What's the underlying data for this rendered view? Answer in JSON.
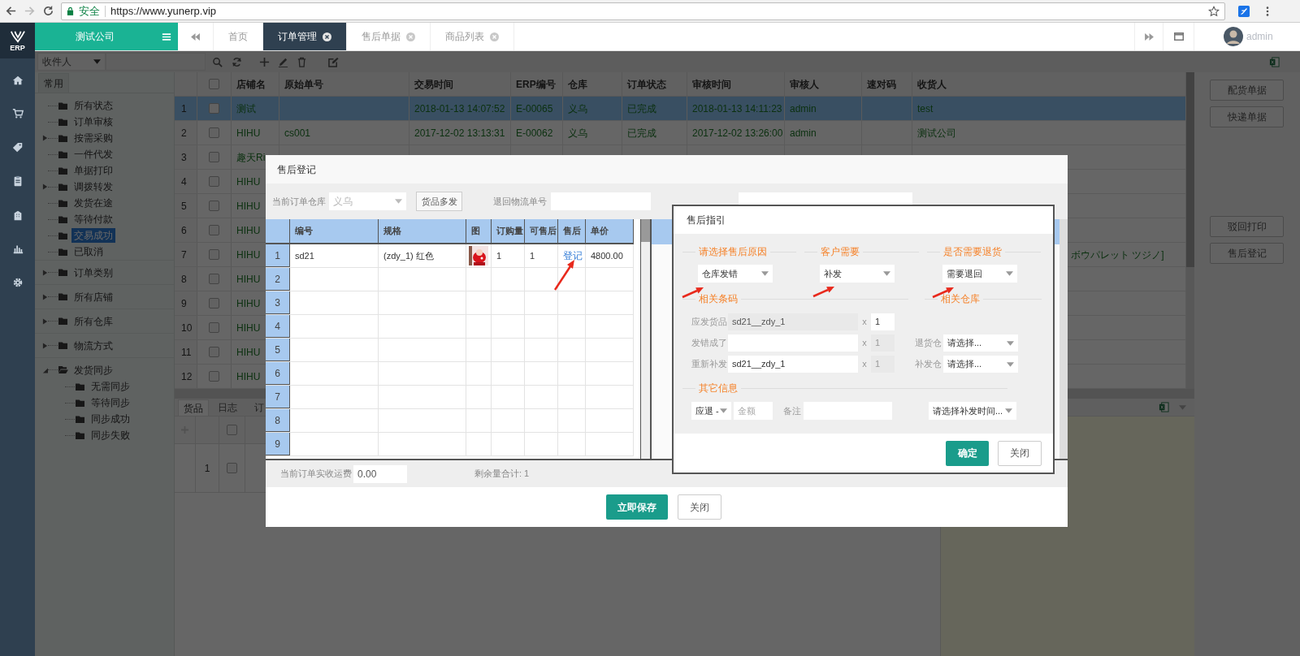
{
  "browser": {
    "security_label": "安全",
    "url": "https://www.yunerp.vip"
  },
  "logo_text": "ERP",
  "company": "测试公司",
  "tabs": [
    {
      "label": "首页",
      "selected": false,
      "closable": false
    },
    {
      "label": "订单管理",
      "selected": true,
      "closable": true
    },
    {
      "label": "售后单据",
      "selected": false,
      "closable": true
    },
    {
      "label": "商品列表",
      "selected": false,
      "closable": true
    }
  ],
  "user": "admin",
  "toolbar": {
    "filter": "收件人"
  },
  "tree": {
    "tab": "常用",
    "sections": [
      {
        "nodes": [
          {
            "label": "所有状态",
            "selected": false
          },
          {
            "label": "订单审核",
            "selected": false
          },
          {
            "label": "按需采购",
            "selected": false,
            "expanded": false
          },
          {
            "label": "一件代发",
            "selected": false
          },
          {
            "label": "单据打印",
            "selected": false
          },
          {
            "label": "调拨转发",
            "selected": false,
            "expanded": false
          },
          {
            "label": "发货在途",
            "selected": false
          },
          {
            "label": "等待付款",
            "selected": false
          },
          {
            "label": "交易成功",
            "selected": true
          },
          {
            "label": "已取消",
            "selected": false
          }
        ]
      },
      {
        "nodes": [
          {
            "label": "订单类别",
            "selected": false,
            "expanded": false
          }
        ]
      },
      {
        "nodes": [
          {
            "label": "所有店铺",
            "selected": false,
            "expanded": false
          }
        ]
      },
      {
        "nodes": [
          {
            "label": "所有仓库",
            "selected": false,
            "expanded": false
          }
        ]
      },
      {
        "nodes": [
          {
            "label": "物流方式",
            "selected": false,
            "expanded": false
          }
        ]
      },
      {
        "nodes": [
          {
            "label": "发货同步",
            "selected": false,
            "expanded": true,
            "children": [
              {
                "label": "无需同步",
                "selected": false
              },
              {
                "label": "等待同步",
                "selected": false
              },
              {
                "label": "同步成功",
                "selected": false
              },
              {
                "label": "同步失败",
                "selected": false
              }
            ]
          }
        ]
      }
    ]
  },
  "grid": {
    "select_all_checked": false,
    "columns": [
      "店铺名",
      "原始单号",
      "交易时间",
      "ERP编号",
      "仓库",
      "订单状态",
      "审核时间",
      "审核人",
      "速对码",
      "收货人"
    ],
    "rows": [
      {
        "no": "1",
        "selected": true,
        "checked": false,
        "cells": [
          "测试",
          null,
          "2018-01-13 14:07:52",
          "E-00065",
          "义乌",
          "已完成",
          "2018-01-13 14:11:23",
          "admin",
          null,
          "test"
        ]
      },
      {
        "no": "2",
        "selected": false,
        "checked": false,
        "cells": [
          "HIHU",
          "cs001",
          "2017-12-02 13:13:31",
          "E-00062",
          "义乌",
          "已完成",
          "2017-12-02 13:26:00",
          "admin",
          null,
          "测试公司"
        ]
      },
      {
        "no": "3",
        "selected": false,
        "checked": false,
        "cells": [
          "趣天Ri"
        ]
      },
      {
        "no": "4",
        "selected": false,
        "checked": false,
        "cells": [
          "HIHU"
        ]
      },
      {
        "no": "5",
        "selected": false,
        "checked": false,
        "cells": [
          "HIHU"
        ]
      },
      {
        "no": "6",
        "selected": false,
        "checked": false,
        "cells": [
          "HIHU"
        ]
      },
      {
        "no": "7",
        "selected": false,
        "checked": false,
        "cells": [
          "HIHU",
          null,
          null,
          null,
          null,
          null,
          null,
          null,
          null,
          "ボウパレット ツジノ]"
        ]
      },
      {
        "no": "8",
        "selected": false,
        "checked": false,
        "cells": [
          "HIHU"
        ]
      },
      {
        "no": "9",
        "selected": false,
        "checked": false,
        "cells": [
          "HIHU"
        ]
      },
      {
        "no": "10",
        "selected": false,
        "checked": false,
        "cells": [
          "HIHU"
        ]
      },
      {
        "no": "11",
        "selected": false,
        "checked": false,
        "cells": [
          "HIHU"
        ]
      },
      {
        "no": "12",
        "selected": false,
        "checked": false,
        "cells": [
          "HIHU"
        ]
      }
    ]
  },
  "right_buttons": [
    [
      "配货单据",
      "快递单据"
    ],
    [
      "驳回打印",
      "售后登记"
    ]
  ],
  "detail": {
    "tabs": [
      {
        "label": "货品",
        "selected": true
      },
      {
        "label": "日志",
        "selected": false
      },
      {
        "label": "订",
        "selected": false
      }
    ],
    "select_all_checked": false,
    "rows": [
      {
        "no": "1",
        "checked": false
      }
    ]
  },
  "modal": {
    "title": "售后登记",
    "warehouse_label": "当前订单仓库",
    "warehouse": "义乌",
    "multi_button": "货品多发",
    "return_no_label": "退回物流单号",
    "table": {
      "columns": [
        {
          "label": "编号",
          "kind": "text"
        },
        {
          "label": "规格",
          "kind": "text"
        },
        {
          "label": "图"
        },
        {
          "label": "订购量",
          "kind": "text"
        },
        {
          "label": "可售后",
          "kind": "text"
        },
        {
          "label": "售后",
          "kind": "link"
        },
        {
          "label": "单价",
          "kind": "text"
        }
      ],
      "rows": [
        {
          "no": "1",
          "cells": [
            "sd21",
            "(zdy_1) 红色",
            {
              "kind": "picture"
            },
            "1",
            "1",
            "登记",
            "4800.00"
          ]
        },
        {
          "no": "2"
        },
        {
          "no": "3"
        },
        {
          "no": "4"
        },
        {
          "no": "5"
        },
        {
          "no": "6"
        },
        {
          "no": "7"
        },
        {
          "no": "8"
        },
        {
          "no": "9"
        }
      ]
    },
    "freight_label": "当前订单实收运费",
    "freight": "0.00",
    "remaining": "剩余量合计: 1",
    "save_button": "立即保存",
    "close_button": "关闭"
  },
  "guide": {
    "title": "售后指引",
    "choices": [
      {
        "heading": "请选择售后原因",
        "value": "仓库发错"
      },
      {
        "heading": "客户需要",
        "value": "补发"
      },
      {
        "heading": "是否需要退货",
        "value": "需要退回"
      }
    ],
    "barcode_heading": "相关条码",
    "warehouse_heading": "相关仓库",
    "barcode_rows": [
      {
        "label": "应发货品",
        "value": "sd21__zdy_1",
        "times": "x",
        "qty": "1",
        "value_disabled": true,
        "qty_disabled": false
      },
      {
        "label": "发错成了",
        "times": "x",
        "qty": "1",
        "value_disabled": false,
        "qty_disabled": true
      },
      {
        "label": "重新补发",
        "value": "sd21__zdy_1",
        "times": "x",
        "qty": "1",
        "value_disabled": false,
        "qty_disabled": true
      }
    ],
    "warehouse_rows": [
      {
        "label": "退货仓",
        "value": "请选择..."
      },
      {
        "label": "补发仓",
        "value": "请选择..."
      }
    ],
    "other_heading": "其它信息",
    "refund_select": "应退 -",
    "amount_placeholder": "金额",
    "note_label": "备注",
    "resend_time_select": "请选择补发时间...",
    "confirm_button": "确定",
    "close_button": "关闭"
  }
}
